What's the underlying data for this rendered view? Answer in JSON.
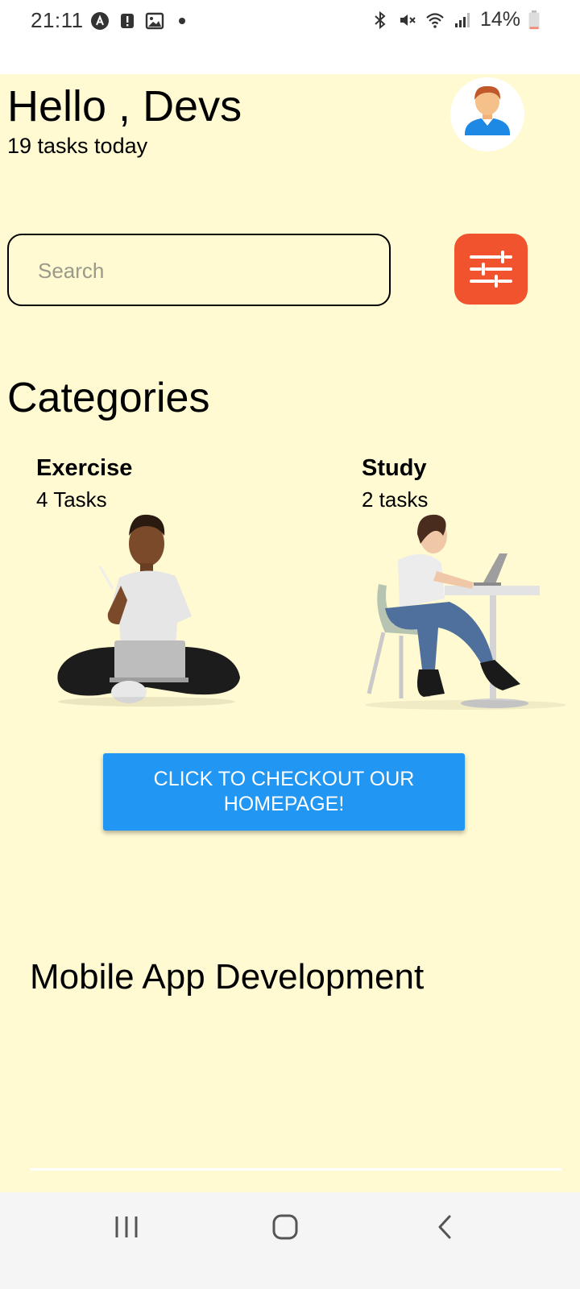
{
  "status_bar": {
    "time": "21:11",
    "left_icons": [
      "app-a-icon",
      "alert-icon",
      "image-icon",
      "dot-icon"
    ],
    "right_icons": [
      "bluetooth-icon",
      "mute-icon",
      "wifi-icon",
      "signal-icon"
    ],
    "battery_percent": "14%",
    "battery_level": 0.14
  },
  "header": {
    "greeting": "Hello , Devs",
    "subtitle": "19 tasks today",
    "avatar_icon": "user-avatar-icon"
  },
  "search": {
    "placeholder": "Search",
    "filter_icon": "sliders-icon",
    "filter_color": "#f0532e"
  },
  "categories": {
    "title": "Categories",
    "items": [
      {
        "name": "Exercise",
        "count": "4 Tasks"
      },
      {
        "name": "Study",
        "count": "2 tasks"
      }
    ]
  },
  "cta": {
    "label": "CLICK TO CHECKOUT OUR HOMEPAGE!",
    "color": "#2196f3"
  },
  "section": {
    "title": "Mobile App Development"
  },
  "colors": {
    "background": "#fffad1"
  },
  "nav_bar": {
    "buttons": [
      "recents-icon",
      "home-icon",
      "back-icon"
    ]
  }
}
